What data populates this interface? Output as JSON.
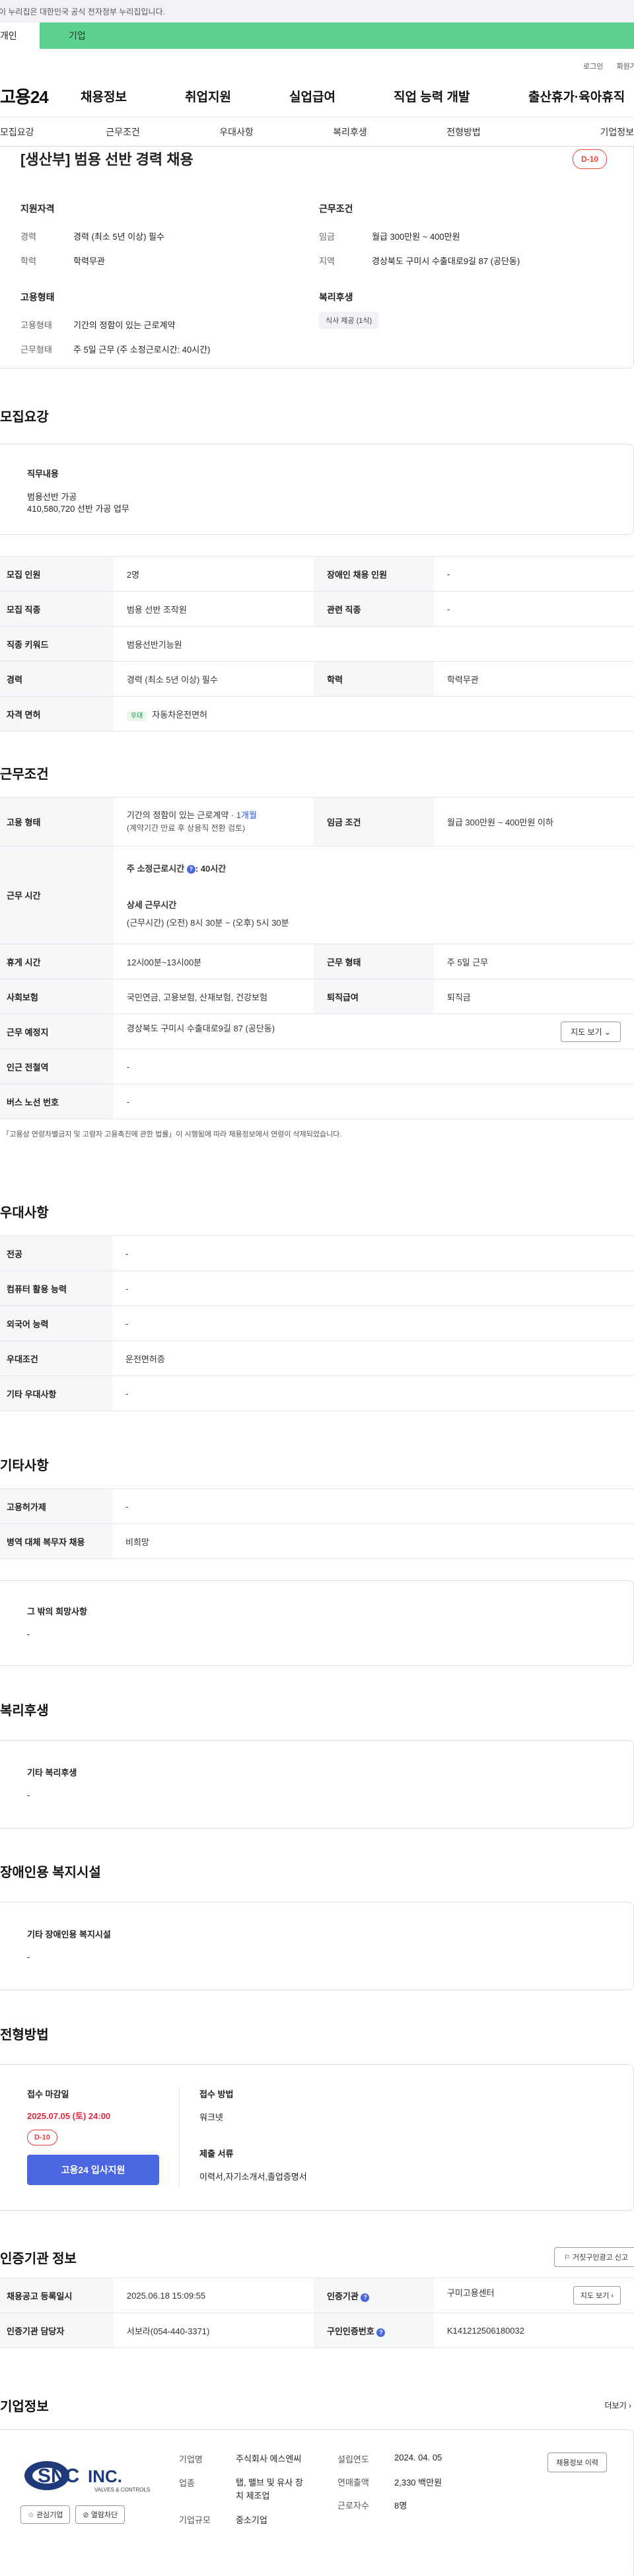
{
  "gov_bar": "이 누리집은 대한민국 공식 전자정부 누리집입니다.",
  "type_tabs": [
    "개인",
    "기업"
  ],
  "util_links": [
    "로그인",
    "회원가입"
  ],
  "logo": "고용24",
  "gnb": [
    "채용정보",
    "취업지원",
    "실업급여",
    "직업 능력 개발",
    "출산휴가·육아휴직"
  ],
  "subtabs": [
    "모집요강",
    "근무조건",
    "우대사항",
    "복리후생",
    "전형방법",
    "기업정보"
  ],
  "summary": {
    "title": "[생산부] 범용 선반 경력 채용",
    "dday": "D-10",
    "qual": {
      "heading": "지원자격",
      "rows": [
        {
          "k": "경력",
          "v": "경력 (최소 5년 이상) 필수"
        },
        {
          "k": "학력",
          "v": "학력무관"
        }
      ]
    },
    "work": {
      "heading": "근무조건",
      "rows": [
        {
          "k": "임금",
          "v": "월급 300만원 ~ 400만원"
        },
        {
          "k": "지역",
          "v": "경상북도 구미시 수출대로9길 87 (공단동)"
        }
      ]
    },
    "emp": {
      "heading": "고용형태",
      "rows": [
        {
          "k": "고용형태",
          "v": "기간의 정함이 있는 근로계약"
        },
        {
          "k": "근무형태",
          "v": "주 5일 근무 (주 소정근로시간: 40시간)"
        }
      ]
    },
    "welfare": {
      "heading": "복리후생",
      "chip": "식사 제공 (1식)"
    }
  },
  "recruit": {
    "heading": "모집요강",
    "duty_label": "직무내용",
    "duty_lines": [
      "범용선반 가공",
      "410,580,720 선반 가공 업무"
    ],
    "rows": [
      [
        "모집 인원",
        "2명",
        "장애인 채용 인원",
        "-"
      ],
      [
        "모집 직종",
        "범용 선반 조작원",
        "관련 직종",
        "-"
      ],
      [
        "직종 키워드",
        "범용선반기능원",
        "",
        ""
      ],
      [
        "경력",
        "경력 (최소 5년 이상) 필수",
        "학력",
        "학력무관"
      ]
    ],
    "license_label": "자격 면허",
    "license_chip": "우대",
    "license_value": "자동차운전면허"
  },
  "conditions": {
    "heading": "근무조건",
    "emp_label": "고용 형태",
    "emp_value": "기간의 정함이 있는 근로계약 · ",
    "emp_period": "1개월",
    "emp_note": "(계약기간 만료 후 상용직 전환 검토)",
    "wage_label": "임금 조건",
    "wage_value": "월급 300만원 ~ 400만원 이하",
    "hours_label": "근무 시간",
    "hours_main": "주 소정근로시간 ",
    "hours_main_val": ": 40시간",
    "hours_detail_label": "상세 근무시간",
    "hours_detail": "(근무시간) (오전) 8시 30분 ~ (오후) 5시 30분",
    "rows": [
      [
        "휴게 시간",
        "12시00분~13시00분",
        "근무 형태",
        "주 5일 근무"
      ],
      [
        "사회보험",
        "국민연금, 고용보험, 산재보험, 건강보험",
        "퇴직급여",
        "퇴직금"
      ]
    ],
    "loc_label": "근무 예정지",
    "loc_value": "경상북도 구미시 수출대로9길 87 (공단동)",
    "map_btn": "지도 보기",
    "subway_label": "인근 전철역",
    "subway_value": "-",
    "bus_label": "버스 노선 번호",
    "bus_value": "-",
    "footnote": "* 「고용상 연령차별금지 및 고령자 고용촉진에 관한 법률」이 시행됨에 따라 채용정보에서 연령이 삭제되었습니다."
  },
  "preferences": {
    "heading": "우대사항",
    "rows": [
      [
        "전공",
        "-"
      ],
      [
        "컴퓨터 활용 능력",
        "-"
      ],
      [
        "외국어 능력",
        "-"
      ],
      [
        "우대조건",
        "운전면허증"
      ],
      [
        "기타 우대사항",
        "-"
      ]
    ]
  },
  "other": {
    "heading": "기타사항",
    "rows": [
      [
        "고용허가제",
        "-"
      ],
      [
        "병역 대체 복무자 채용",
        "비희망"
      ]
    ],
    "box_label": "그 밖의 희망사항",
    "box_value": "-"
  },
  "benefits": {
    "heading": "복리후생",
    "box_label": "기타 복리후생",
    "box_value": "-"
  },
  "disability": {
    "heading": "장애인용 복지시설",
    "box_label": "기타 장애인용 복지시설",
    "box_value": "-"
  },
  "selection": {
    "heading": "전형방법",
    "deadline_label": "접수 마감일",
    "deadline": "2025.07.05 (토) 24:00",
    "dday": "D-10",
    "apply_btn": "고용24 입사지원",
    "method_label": "접수 방법",
    "method": "워크넷",
    "docs_label": "제출 서류",
    "docs": "이력서,자기소개서,졸업증명서"
  },
  "agency": {
    "heading": "인증기관 정보",
    "report_btn": "거짓구인광고 신고",
    "row1": [
      "채용공고 등록일시",
      "2025.06.18 15:09:55",
      "인증기관",
      "구미고용센터"
    ],
    "map_btn": "지도 보기",
    "row2": [
      "인증기관 담당자",
      "서보라(054-440-3371)",
      "구인인증번호",
      "K141212506180032"
    ]
  },
  "company": {
    "heading": "기업정보",
    "more": "더보기",
    "logo_text": "SNC INC.",
    "logo_sub": "VALVES & CONTROLS",
    "fav_btn": "관심기업",
    "block_btn": "열람차단",
    "name_label": "기업명",
    "name": "주식회사 에스엔씨",
    "biz_label": "업종",
    "biz": "탭, 밸브 및 유사 장치 제조업",
    "size_label": "기업규모",
    "size": "중소기업",
    "est_label": "설립연도",
    "est": "2024. 04. 05",
    "sales_label": "연매출액",
    "sales": "2,330 백만원",
    "emp_label": "근로자수",
    "emp": "8명",
    "history_btn": "채용정보 이력"
  },
  "colors": {
    "accent_green": "#5dd18d",
    "dday_red": "#e43b3b",
    "apply_blue": "#4a66e0",
    "deadline_red": "#e0283e"
  }
}
